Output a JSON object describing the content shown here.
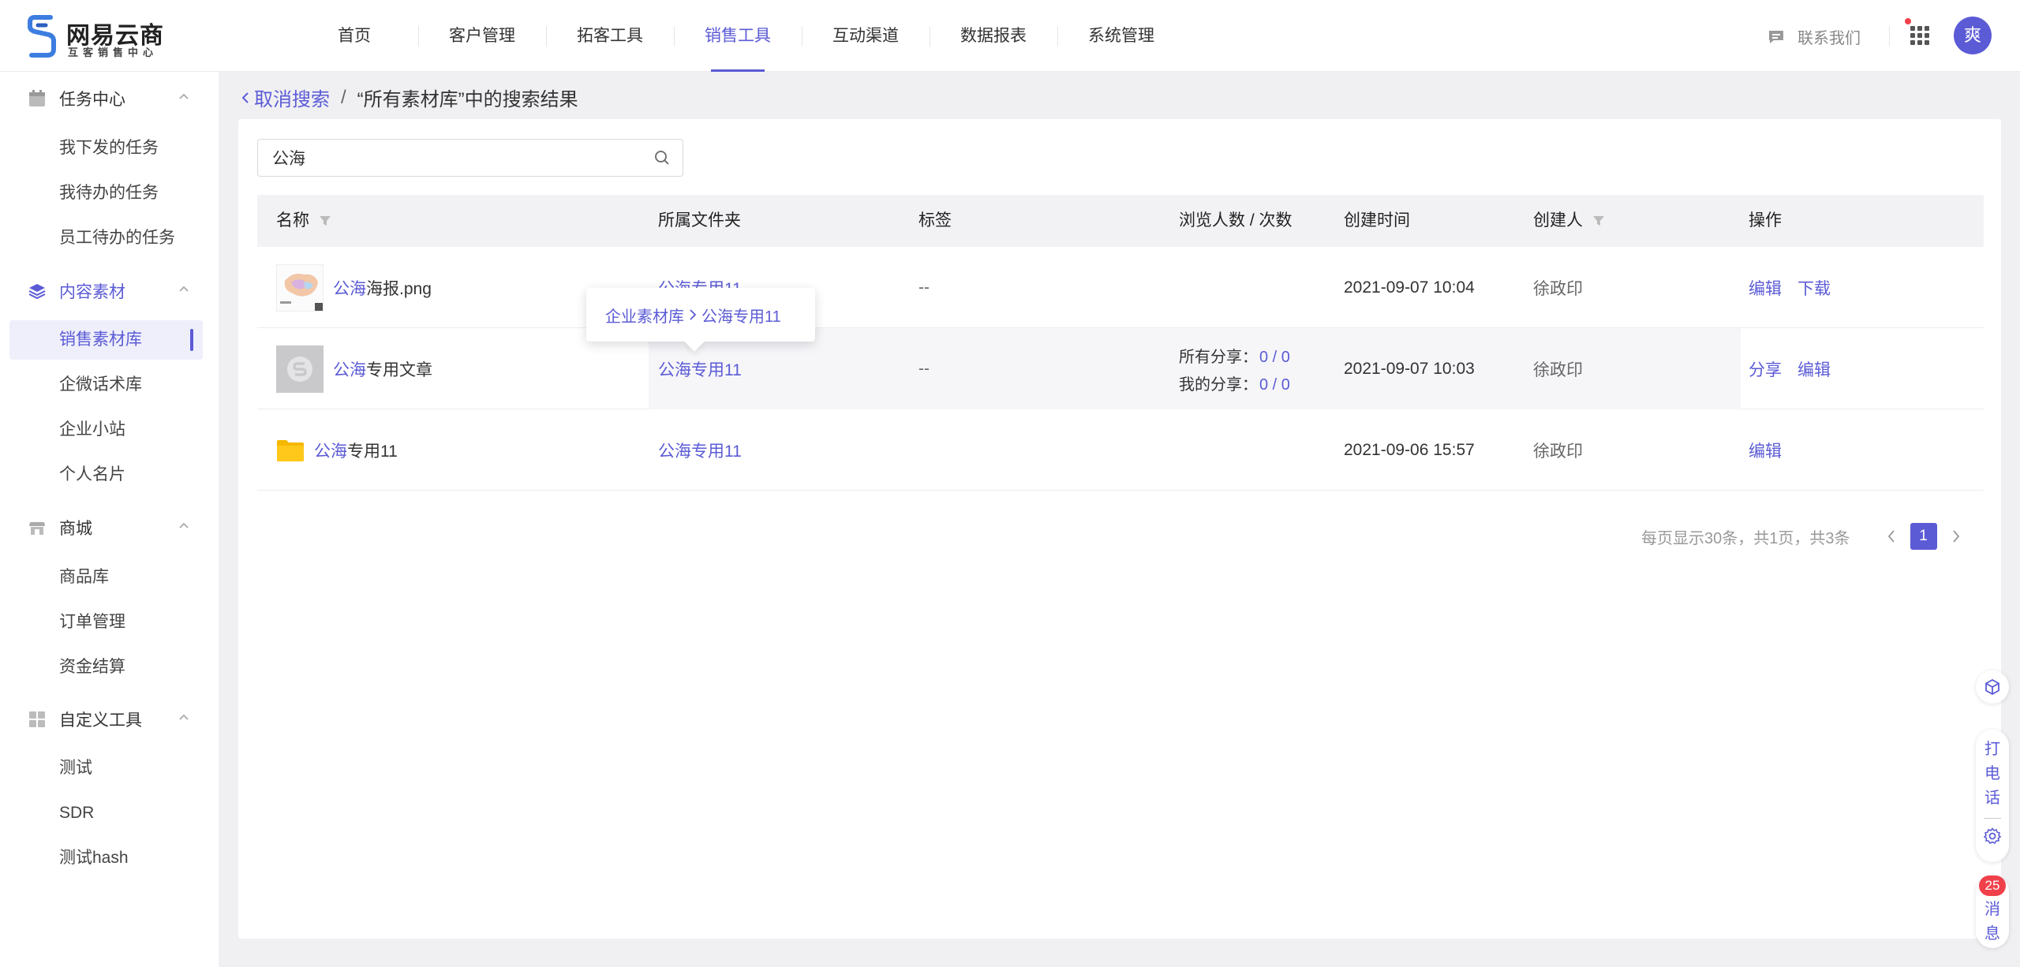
{
  "brand": {
    "title": "网易云商",
    "subtitle": "互客销售中心"
  },
  "nav": {
    "items": [
      {
        "label": "首页"
      },
      {
        "label": "客户管理"
      },
      {
        "label": "拓客工具"
      },
      {
        "label": "销售工具",
        "active": true
      },
      {
        "label": "互动渠道"
      },
      {
        "label": "数据报表"
      },
      {
        "label": "系统管理"
      }
    ],
    "contact_label": "联系我们",
    "avatar_text": "爽"
  },
  "sidebar": {
    "groups": [
      {
        "label": "任务中心",
        "items": [
          "我下发的任务",
          "我待办的任务",
          "员工待办的任务"
        ]
      },
      {
        "label": "内容素材",
        "active": true,
        "items": [
          "销售素材库",
          "企微话术库",
          "企业小站",
          "个人名片"
        ]
      },
      {
        "label": "商城",
        "items": [
          "商品库",
          "订单管理",
          "资金结算"
        ]
      },
      {
        "label": "自定义工具",
        "items": [
          "测试",
          "SDR",
          "测试hash"
        ]
      }
    ],
    "active_item": "销售素材库"
  },
  "breadcrumb": {
    "back_label": "取消搜索",
    "separator": "/",
    "current": "“所有素材库”中的搜索结果"
  },
  "search": {
    "value": "公海",
    "placeholder": ""
  },
  "table": {
    "headers": {
      "name": "名称",
      "folder": "所属文件夹",
      "tags": "标签",
      "views": "浏览人数 / 次数",
      "created": "创建时间",
      "creator": "创建人",
      "actions": "操作"
    },
    "rows": [
      {
        "type": "image",
        "name_hit": "公海",
        "name_rest": "海报.png",
        "folder": "公海专用11",
        "tags": "--",
        "share_all_label": "",
        "share_all": "",
        "share_mine_label": "",
        "share_mine": "",
        "created": "2021-09-07 10:04",
        "creator": "徐政印",
        "action1": "编辑",
        "action2": "下载"
      },
      {
        "type": "article",
        "name_hit": "公海",
        "name_rest": "专用文章",
        "folder": "公海专用11",
        "tags": "--",
        "share_all_label": "所有分享：",
        "share_all": "0 / 0",
        "share_mine_label": "我的分享：",
        "share_mine": "0 / 0",
        "created": "2021-09-07 10:03",
        "creator": "徐政印",
        "action1": "分享",
        "action2": "编辑"
      },
      {
        "type": "folder",
        "name_hit": "公海",
        "name_rest": "专用11",
        "folder": "公海专用11",
        "tags": "",
        "share_all_label": "",
        "share_all": "",
        "share_mine_label": "",
        "share_mine": "",
        "created": "2021-09-06 15:57",
        "creator": "徐政印",
        "action1": "编辑",
        "action2": ""
      }
    ]
  },
  "tooltip": {
    "parent": "企业素材库",
    "child": "公海专用11"
  },
  "pager": {
    "info": "每页显示30条，共1页，共3条",
    "current_page": "1"
  },
  "floating": {
    "call_label": "打电话",
    "msg_label": "消息",
    "msg_badge": "25"
  },
  "colors": {
    "accent": "#5b5bd6",
    "badge": "#f0414b",
    "folder": "#f5b800"
  }
}
